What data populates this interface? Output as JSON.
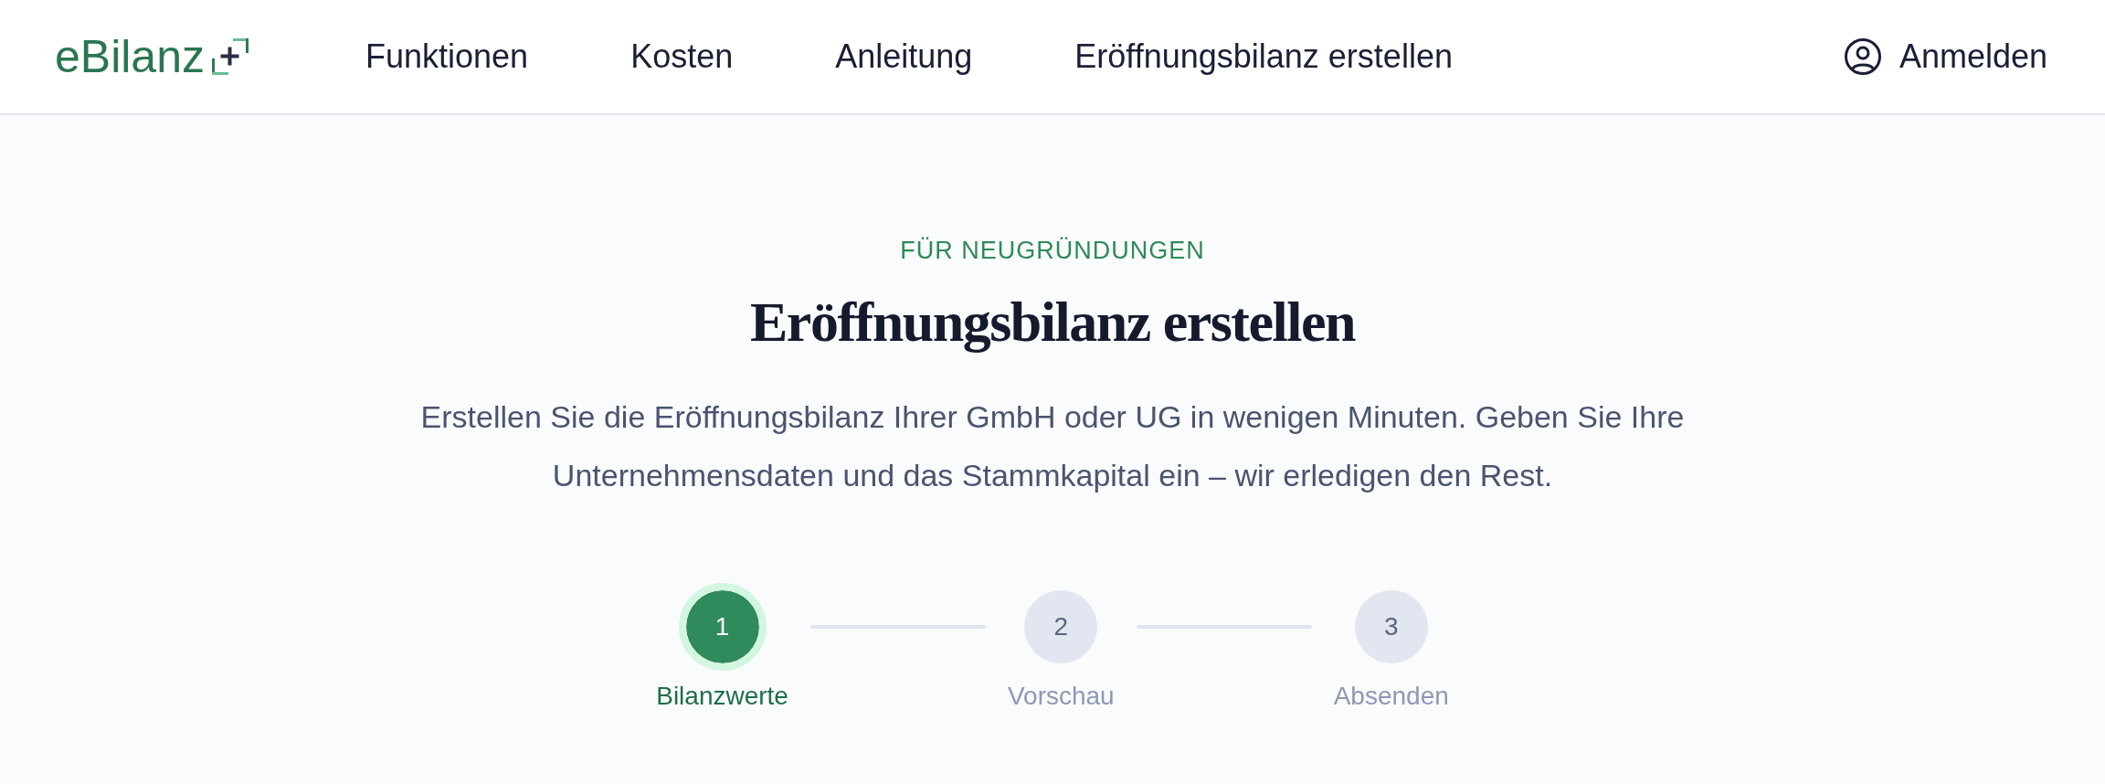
{
  "header": {
    "logo": {
      "text": "eBilanz"
    },
    "nav": [
      {
        "label": "Funktionen"
      },
      {
        "label": "Kosten"
      },
      {
        "label": "Anleitung"
      },
      {
        "label": "Eröffnungsbilanz erstellen"
      }
    ],
    "login": {
      "label": "Anmelden"
    }
  },
  "hero": {
    "eyebrow": "FÜR NEUGRÜNDUNGEN",
    "title": "Eröffnungsbilanz erstellen",
    "description": "Erstellen Sie die Eröffnungsbilanz Ihrer GmbH oder UG in wenigen Minuten. Geben Sie Ihre Unternehmensdaten und das Stammkapital ein – wir erledigen den Rest."
  },
  "steps": [
    {
      "number": "1",
      "label": "Bilanzwerte",
      "selected": true
    },
    {
      "number": "2",
      "label": "Vorschau",
      "selected": false
    },
    {
      "number": "3",
      "label": "Absenden",
      "selected": false
    }
  ]
}
